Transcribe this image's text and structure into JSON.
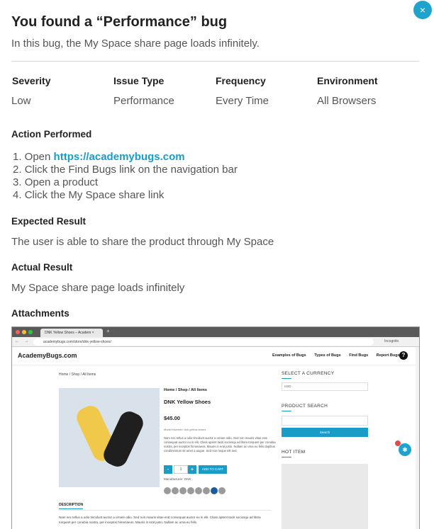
{
  "close_label": "×",
  "title": "You found a “Performance” bug",
  "subtitle": "In this bug, the My Space share page loads infinitely.",
  "meta": [
    {
      "label": "Severity",
      "value": "Low"
    },
    {
      "label": "Issue Type",
      "value": "Performance"
    },
    {
      "label": "Frequency",
      "value": "Every Time"
    },
    {
      "label": "Environment",
      "value": "All Browsers"
    }
  ],
  "action": {
    "heading": "Action Performed",
    "steps": [
      {
        "num": "1. Open ",
        "text": "",
        "link": "https://academybugs.com"
      },
      {
        "num": "2. ",
        "text": "Click the Find Bugs link on the navigation bar",
        "link": ""
      },
      {
        "num": "3. ",
        "text": "Open a product",
        "link": ""
      },
      {
        "num": "4. ",
        "text": "Click the My Space share link",
        "link": ""
      }
    ]
  },
  "expected": {
    "heading": "Expected Result",
    "text": "The user is able to share the product through My Space"
  },
  "actual": {
    "heading": "Actual Result",
    "text": "My Space share page loads infinitely"
  },
  "attachments": {
    "heading": "Attachments"
  },
  "screenshot": {
    "tab_title": "DNK Yellow Shoes – Academ",
    "tab_close": "×",
    "new_tab": "+",
    "nav_arrows": "← → C",
    "url": "academybugs.com/store/dnk-yellow-shoes/",
    "incognito": "Incognito",
    "logo": "AcademyBugs.com",
    "nav": [
      "Examples of Bugs",
      "Types of Bugs",
      "Find Bugs",
      "Report Bugs"
    ],
    "help": "?",
    "breadcrumb": "Home / Shop / All Items",
    "product_breadcrumb": "Home / Shop / All Items",
    "product_name": "DNK Yellow Shoes",
    "price": "$45.00",
    "model": "Model Number: dnk-yellow-shoes",
    "description_short": "Nam nec tellus a odio tincidunt auctor a ornare odio. Sed non mauris vitae erat consequat auctor eu in elit. Class aptent taciti sociosqu ad litora torquent per conubia nostra, per inceptos himenaeos. Mauris in erat justo. Nullam ac urna eu felis dapibus condimentum sit amet a augue. Sed non neque elit sed.",
    "qty_minus": "-",
    "qty": "1",
    "qty_plus": "+",
    "add_to_cart": "ADD TO CART",
    "manufacturer": "Manufacturer: DNK",
    "description_tab": "DESCRIPTION",
    "description_long": "Nam nec tellus a odio tincidunt auctor a ornare odio. Sed non mauris vitae erat consequat auctor eu in elit. Class aptent taciti sociosqu ad litora torquent per conubia nostra, per inceptos himenaeos. Mauris in erat justo. Nullam ac urna eu felis",
    "side_currency": "SELECT A CURRENCY",
    "currency_value": "USD",
    "side_search": "PRODUCT SEARCH",
    "search_button": "Search",
    "side_hot": "HOT ITEM",
    "accent": "#1a9cc9"
  }
}
